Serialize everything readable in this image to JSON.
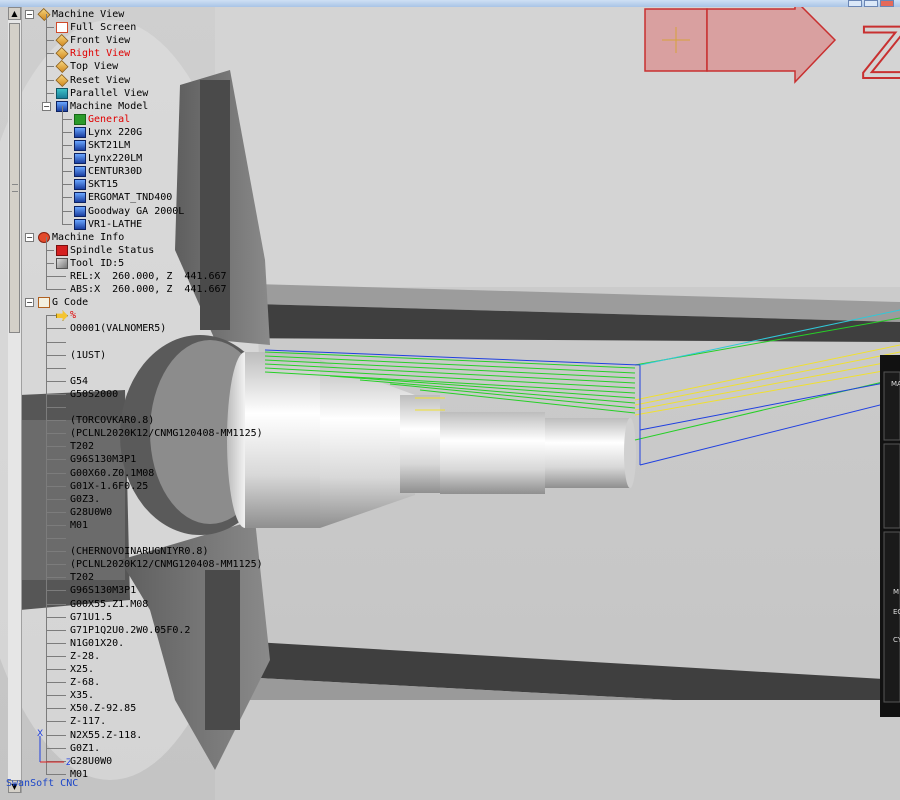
{
  "tree": {
    "machine_view": {
      "label": "Machine View",
      "items": [
        "Full Screen",
        "Front View",
        "Right View",
        "Top View",
        "Reset View",
        "Parallel View"
      ],
      "active": "Right View"
    },
    "machine_model": {
      "label": "Machine Model",
      "items": [
        "General",
        "Lynx 220G",
        "SKT21LM",
        "Lynx220LM",
        "CENTUR30D",
        "SKT15",
        "ERGOMAT_TND400",
        "Goodway GA 2000L",
        "VR1-LATHE"
      ],
      "active": "General"
    },
    "machine_info": {
      "label": "Machine Info",
      "spindle_status": "Spindle Status",
      "tool_id": "Tool ID:5",
      "rel": "REL:X  260.000, Z  441.667",
      "abs": "ABS:X  260.000, Z  441.667"
    },
    "g_code": {
      "label": "G Code",
      "lines": [
        "%",
        "O0001(VALNOMER5)",
        "",
        "(1UST)",
        "",
        "G54",
        "G50S2000",
        "",
        "(TORCOVKAR0.8)",
        "(PCLNL2020K12/CNMG120408-MM1125)",
        "T202",
        "G96S130M3P1",
        "G00X60.Z0.1M08",
        "G01X-1.6F0.25",
        "G0Z3.",
        "G28U0W0",
        "M01",
        "",
        "(CHERNOVOINARUGNIYR0.8)",
        "(PCLNL2020K12/CNMG120408-MM1125)",
        "T202",
        "G96S130M3P1",
        "G00X55.Z1.M08",
        "G71U1.5",
        "G71P1Q2U0.2W0.05F0.2",
        "N1G01X20.",
        "Z-28.",
        "X25.",
        "Z-68.",
        "X35.",
        "X50.Z-92.85",
        "Z-117.",
        "N2X55.Z-118.",
        "G0Z1.",
        "G28U0W0",
        "M01"
      ],
      "current_line": "%"
    }
  },
  "axes": {
    "x_label": "X",
    "z_label": "Z"
  },
  "brand": "SwanSoft CNC",
  "scrollbar": {
    "up": "▲",
    "down": "▼"
  },
  "colors": {
    "highlight": "#e00000",
    "brand": "#1d47c8",
    "toolpath_green": "#26d026",
    "toolpath_yellow": "#f0e030",
    "toolpath_blue": "#2040e0",
    "toolpath_cyan": "#30c8d8",
    "arrow_red": "#c83030"
  },
  "overlay": {
    "banner_letter": "Z",
    "panel_labels": [
      "MA",
      "M",
      "EC",
      "CY"
    ]
  }
}
